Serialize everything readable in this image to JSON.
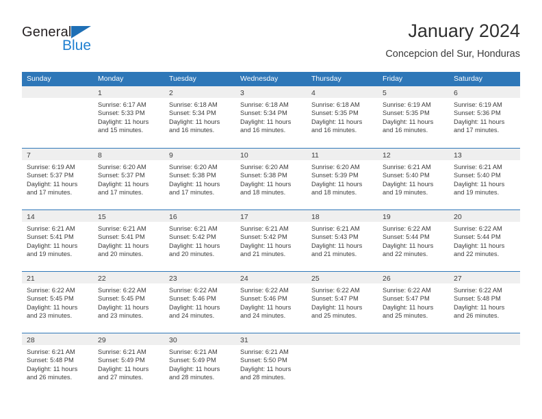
{
  "brand": {
    "name_top": "General",
    "name_bottom": "Blue",
    "accent_color": "#1f7fd0",
    "triangle_color": "#1f6fb5"
  },
  "header": {
    "title": "January 2024",
    "subtitle": "Concepcion del Sur, Honduras"
  },
  "theme": {
    "header_row_bg": "#2e77b8",
    "day_band_bg": "#efefef",
    "separator_color": "#2e77b8",
    "text_color": "#3b3b3b"
  },
  "weekdays": [
    "Sunday",
    "Monday",
    "Tuesday",
    "Wednesday",
    "Thursday",
    "Friday",
    "Saturday"
  ],
  "weeks": [
    [
      {
        "day": "",
        "sunrise": "",
        "sunset": "",
        "daylight_l1": "",
        "daylight_l2": ""
      },
      {
        "day": "1",
        "sunrise": "Sunrise: 6:17 AM",
        "sunset": "Sunset: 5:33 PM",
        "daylight_l1": "Daylight: 11 hours",
        "daylight_l2": "and 15 minutes."
      },
      {
        "day": "2",
        "sunrise": "Sunrise: 6:18 AM",
        "sunset": "Sunset: 5:34 PM",
        "daylight_l1": "Daylight: 11 hours",
        "daylight_l2": "and 16 minutes."
      },
      {
        "day": "3",
        "sunrise": "Sunrise: 6:18 AM",
        "sunset": "Sunset: 5:34 PM",
        "daylight_l1": "Daylight: 11 hours",
        "daylight_l2": "and 16 minutes."
      },
      {
        "day": "4",
        "sunrise": "Sunrise: 6:18 AM",
        "sunset": "Sunset: 5:35 PM",
        "daylight_l1": "Daylight: 11 hours",
        "daylight_l2": "and 16 minutes."
      },
      {
        "day": "5",
        "sunrise": "Sunrise: 6:19 AM",
        "sunset": "Sunset: 5:35 PM",
        "daylight_l1": "Daylight: 11 hours",
        "daylight_l2": "and 16 minutes."
      },
      {
        "day": "6",
        "sunrise": "Sunrise: 6:19 AM",
        "sunset": "Sunset: 5:36 PM",
        "daylight_l1": "Daylight: 11 hours",
        "daylight_l2": "and 17 minutes."
      }
    ],
    [
      {
        "day": "7",
        "sunrise": "Sunrise: 6:19 AM",
        "sunset": "Sunset: 5:37 PM",
        "daylight_l1": "Daylight: 11 hours",
        "daylight_l2": "and 17 minutes."
      },
      {
        "day": "8",
        "sunrise": "Sunrise: 6:20 AM",
        "sunset": "Sunset: 5:37 PM",
        "daylight_l1": "Daylight: 11 hours",
        "daylight_l2": "and 17 minutes."
      },
      {
        "day": "9",
        "sunrise": "Sunrise: 6:20 AM",
        "sunset": "Sunset: 5:38 PM",
        "daylight_l1": "Daylight: 11 hours",
        "daylight_l2": "and 17 minutes."
      },
      {
        "day": "10",
        "sunrise": "Sunrise: 6:20 AM",
        "sunset": "Sunset: 5:38 PM",
        "daylight_l1": "Daylight: 11 hours",
        "daylight_l2": "and 18 minutes."
      },
      {
        "day": "11",
        "sunrise": "Sunrise: 6:20 AM",
        "sunset": "Sunset: 5:39 PM",
        "daylight_l1": "Daylight: 11 hours",
        "daylight_l2": "and 18 minutes."
      },
      {
        "day": "12",
        "sunrise": "Sunrise: 6:21 AM",
        "sunset": "Sunset: 5:40 PM",
        "daylight_l1": "Daylight: 11 hours",
        "daylight_l2": "and 19 minutes."
      },
      {
        "day": "13",
        "sunrise": "Sunrise: 6:21 AM",
        "sunset": "Sunset: 5:40 PM",
        "daylight_l1": "Daylight: 11 hours",
        "daylight_l2": "and 19 minutes."
      }
    ],
    [
      {
        "day": "14",
        "sunrise": "Sunrise: 6:21 AM",
        "sunset": "Sunset: 5:41 PM",
        "daylight_l1": "Daylight: 11 hours",
        "daylight_l2": "and 19 minutes."
      },
      {
        "day": "15",
        "sunrise": "Sunrise: 6:21 AM",
        "sunset": "Sunset: 5:41 PM",
        "daylight_l1": "Daylight: 11 hours",
        "daylight_l2": "and 20 minutes."
      },
      {
        "day": "16",
        "sunrise": "Sunrise: 6:21 AM",
        "sunset": "Sunset: 5:42 PM",
        "daylight_l1": "Daylight: 11 hours",
        "daylight_l2": "and 20 minutes."
      },
      {
        "day": "17",
        "sunrise": "Sunrise: 6:21 AM",
        "sunset": "Sunset: 5:42 PM",
        "daylight_l1": "Daylight: 11 hours",
        "daylight_l2": "and 21 minutes."
      },
      {
        "day": "18",
        "sunrise": "Sunrise: 6:21 AM",
        "sunset": "Sunset: 5:43 PM",
        "daylight_l1": "Daylight: 11 hours",
        "daylight_l2": "and 21 minutes."
      },
      {
        "day": "19",
        "sunrise": "Sunrise: 6:22 AM",
        "sunset": "Sunset: 5:44 PM",
        "daylight_l1": "Daylight: 11 hours",
        "daylight_l2": "and 22 minutes."
      },
      {
        "day": "20",
        "sunrise": "Sunrise: 6:22 AM",
        "sunset": "Sunset: 5:44 PM",
        "daylight_l1": "Daylight: 11 hours",
        "daylight_l2": "and 22 minutes."
      }
    ],
    [
      {
        "day": "21",
        "sunrise": "Sunrise: 6:22 AM",
        "sunset": "Sunset: 5:45 PM",
        "daylight_l1": "Daylight: 11 hours",
        "daylight_l2": "and 23 minutes."
      },
      {
        "day": "22",
        "sunrise": "Sunrise: 6:22 AM",
        "sunset": "Sunset: 5:45 PM",
        "daylight_l1": "Daylight: 11 hours",
        "daylight_l2": "and 23 minutes."
      },
      {
        "day": "23",
        "sunrise": "Sunrise: 6:22 AM",
        "sunset": "Sunset: 5:46 PM",
        "daylight_l1": "Daylight: 11 hours",
        "daylight_l2": "and 24 minutes."
      },
      {
        "day": "24",
        "sunrise": "Sunrise: 6:22 AM",
        "sunset": "Sunset: 5:46 PM",
        "daylight_l1": "Daylight: 11 hours",
        "daylight_l2": "and 24 minutes."
      },
      {
        "day": "25",
        "sunrise": "Sunrise: 6:22 AM",
        "sunset": "Sunset: 5:47 PM",
        "daylight_l1": "Daylight: 11 hours",
        "daylight_l2": "and 25 minutes."
      },
      {
        "day": "26",
        "sunrise": "Sunrise: 6:22 AM",
        "sunset": "Sunset: 5:47 PM",
        "daylight_l1": "Daylight: 11 hours",
        "daylight_l2": "and 25 minutes."
      },
      {
        "day": "27",
        "sunrise": "Sunrise: 6:22 AM",
        "sunset": "Sunset: 5:48 PM",
        "daylight_l1": "Daylight: 11 hours",
        "daylight_l2": "and 26 minutes."
      }
    ],
    [
      {
        "day": "28",
        "sunrise": "Sunrise: 6:21 AM",
        "sunset": "Sunset: 5:48 PM",
        "daylight_l1": "Daylight: 11 hours",
        "daylight_l2": "and 26 minutes."
      },
      {
        "day": "29",
        "sunrise": "Sunrise: 6:21 AM",
        "sunset": "Sunset: 5:49 PM",
        "daylight_l1": "Daylight: 11 hours",
        "daylight_l2": "and 27 minutes."
      },
      {
        "day": "30",
        "sunrise": "Sunrise: 6:21 AM",
        "sunset": "Sunset: 5:49 PM",
        "daylight_l1": "Daylight: 11 hours",
        "daylight_l2": "and 28 minutes."
      },
      {
        "day": "31",
        "sunrise": "Sunrise: 6:21 AM",
        "sunset": "Sunset: 5:50 PM",
        "daylight_l1": "Daylight: 11 hours",
        "daylight_l2": "and 28 minutes."
      },
      {
        "day": "",
        "sunrise": "",
        "sunset": "",
        "daylight_l1": "",
        "daylight_l2": ""
      },
      {
        "day": "",
        "sunrise": "",
        "sunset": "",
        "daylight_l1": "",
        "daylight_l2": ""
      },
      {
        "day": "",
        "sunrise": "",
        "sunset": "",
        "daylight_l1": "",
        "daylight_l2": ""
      }
    ]
  ]
}
